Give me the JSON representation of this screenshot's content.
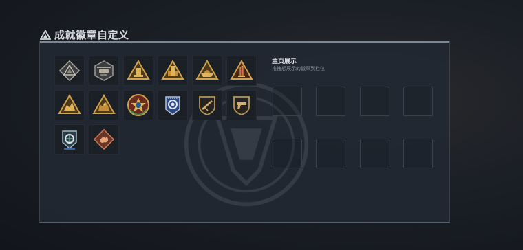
{
  "window": {
    "title": "成就徽章自定义",
    "title_icon": "triangle-icon"
  },
  "showcase": {
    "title": "主页展示",
    "hint": "拖拽想展示的徽章到栏位",
    "slots": 8,
    "slots_filled": 0
  },
  "badges": [
    {
      "icon": "mountain-triangle-badge-icon",
      "tier": "gray"
    },
    {
      "icon": "helicopter-badge-icon",
      "tier": "gray"
    },
    {
      "icon": "tower-triangle-badge-icon",
      "tier": "gold"
    },
    {
      "icon": "building-triangle-badge-icon",
      "tier": "gold"
    },
    {
      "icon": "ship-triangle-badge-icon",
      "tier": "gold"
    },
    {
      "icon": "number-one-triangle-badge-icon",
      "tier": "gold"
    },
    {
      "icon": "rider-triangle-badge-icon",
      "tier": "gold"
    },
    {
      "icon": "beast-triangle-badge-icon",
      "tier": "gold"
    },
    {
      "icon": "star-wreath-badge-icon",
      "tier": "colorful"
    },
    {
      "icon": "blue-shield-badge-icon",
      "tier": "blue"
    },
    {
      "icon": "rifle-shield-badge-icon",
      "tier": "dark-gold"
    },
    {
      "icon": "pistol-shield-badge-icon",
      "tier": "dark-gold"
    },
    {
      "icon": "emblem-shield-badge-icon",
      "tier": "silver-blue"
    },
    {
      "icon": "dragon-diamond-badge-icon",
      "tier": "copper"
    }
  ],
  "colors": {
    "panel_bg": "#222832",
    "gold": "#c99a44",
    "text_primary": "#dfe2e6",
    "text_secondary": "#8e96a0"
  }
}
